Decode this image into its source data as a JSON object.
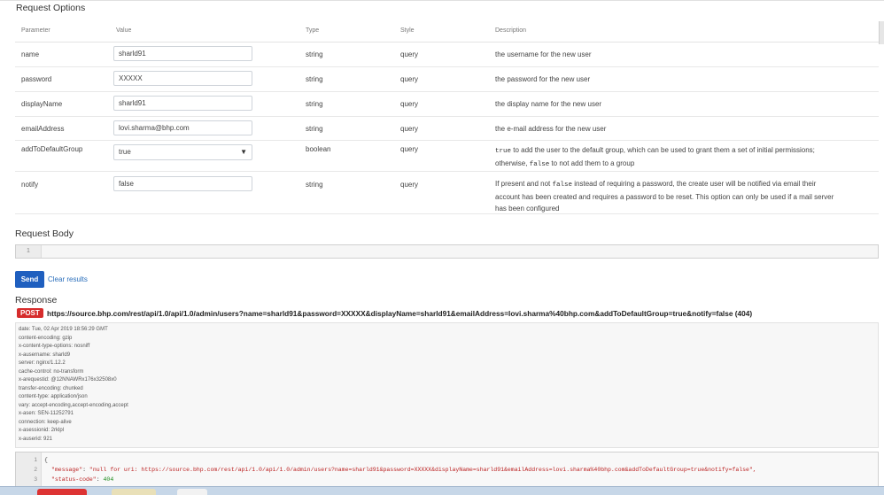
{
  "sections": {
    "request_options": "Request Options",
    "request_body": "Request Body",
    "response": "Response"
  },
  "table": {
    "headers": {
      "parameter": "Parameter",
      "value": "Value",
      "type": "Type",
      "style": "Style",
      "description": "Description"
    },
    "rows": [
      {
        "parameter": "name",
        "value": "sharld91",
        "type": "string",
        "style": "query",
        "description": "the username for the new user"
      },
      {
        "parameter": "password",
        "value": "XXXXX",
        "type": "string",
        "style": "query",
        "description": "the password for the new user"
      },
      {
        "parameter": "displayName",
        "value": "sharld91",
        "type": "string",
        "style": "query",
        "description": "the display name for the new user"
      },
      {
        "parameter": "emailAddress",
        "value": "lovi.sharma@bhp.com",
        "type": "string",
        "style": "query",
        "description": "the e-mail address for the new user"
      },
      {
        "parameter": "addToDefaultGroup",
        "value": "true",
        "type": "boolean",
        "style": "query",
        "description_code1": "true",
        "description_part1": " to add the user to the default group, which can be used to grant them a set of initial permissions;",
        "description_part2a": "otherwise, ",
        "description_code2": "false",
        "description_part2b": " to not add them to a group"
      },
      {
        "parameter": "notify",
        "value": "false",
        "type": "string",
        "style": "query",
        "description_part1a": "If present and not ",
        "description_code1": "false",
        "description_part1b": " instead of requiring a password, the create user will be notified via email their",
        "description_line2": "account has been created and requires a password to be reset. This option can only be used if a mail server",
        "description_line3": "has been configured"
      }
    ]
  },
  "request_body": {
    "line_number": "1"
  },
  "buttons": {
    "send": "Send",
    "clear": "Clear results"
  },
  "response": {
    "method": "POST",
    "url_line": "https://source.bhp.com/rest/api/1.0/api/1.0/admin/users?name=sharld91&password=XXXXX&displayName=sharld91&emailAddress=lovi.sharma%40bhp.com&addToDefaultGroup=true&notify=false (404)",
    "headers": [
      "date: Tue, 02 Apr 2019 18:56:29 GMT",
      "content-encoding: gzip",
      "x-content-type-options: nosniff",
      "x-ausername: sharld9",
      "server: nginx/1.12.2",
      "cache-control: no-transform",
      "x-arequestid: @12NNAWRx176x32508x0",
      "transfer-encoding: chunked",
      "content-type: application/json",
      "vary: accept-encoding,accept-encoding,accept",
      "x-asen: SEN-11252791",
      "connection: keep-alive",
      "x-asessionid: 2rklpl",
      "x-auserid: 921"
    ],
    "body": {
      "line1_num": "1",
      "line1": "{",
      "line2_num": "2",
      "line2_key": "\"message\"",
      "line2_val": "\"null for uri: https://source.bhp.com/rest/api/1.0/api/1.0/admin/users?name=sharld91&password=XXXXX&displayName=sharld91&emailAddress=lovi.sharma%40bhp.com&addToDefaultGroup=true&notify=false\",",
      "line3_num": "3",
      "line3_key": "\"status-code\"",
      "line3_val": "404"
    }
  },
  "colors": {
    "accent": "#1f5fbf",
    "post": "#d62c2c",
    "link": "#2a6ebb"
  }
}
